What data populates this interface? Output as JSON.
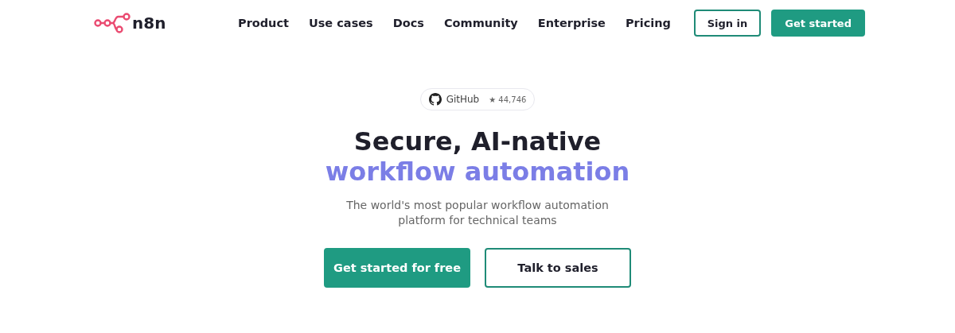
{
  "header": {
    "logo_text": "n8n",
    "nav": [
      {
        "label": "Product"
      },
      {
        "label": "Use cases"
      },
      {
        "label": "Docs"
      },
      {
        "label": "Community"
      },
      {
        "label": "Enterprise"
      },
      {
        "label": "Pricing"
      }
    ],
    "buttons": [
      {
        "label": "Sign in",
        "kind": "outline"
      },
      {
        "label": "Get started",
        "kind": "filled"
      }
    ]
  },
  "hero": {
    "badge": {
      "label": "GitHub",
      "stars": "★ 44,746"
    },
    "headline": "Secure, AI-native",
    "headline_accent": "workflow automation",
    "subtitle": "The world's most popular workflow automation platform for technical teams",
    "buttons": [
      {
        "label": "Get started for free",
        "kind": "filled"
      },
      {
        "label": "Talk to sales",
        "kind": "outline"
      }
    ]
  }
}
